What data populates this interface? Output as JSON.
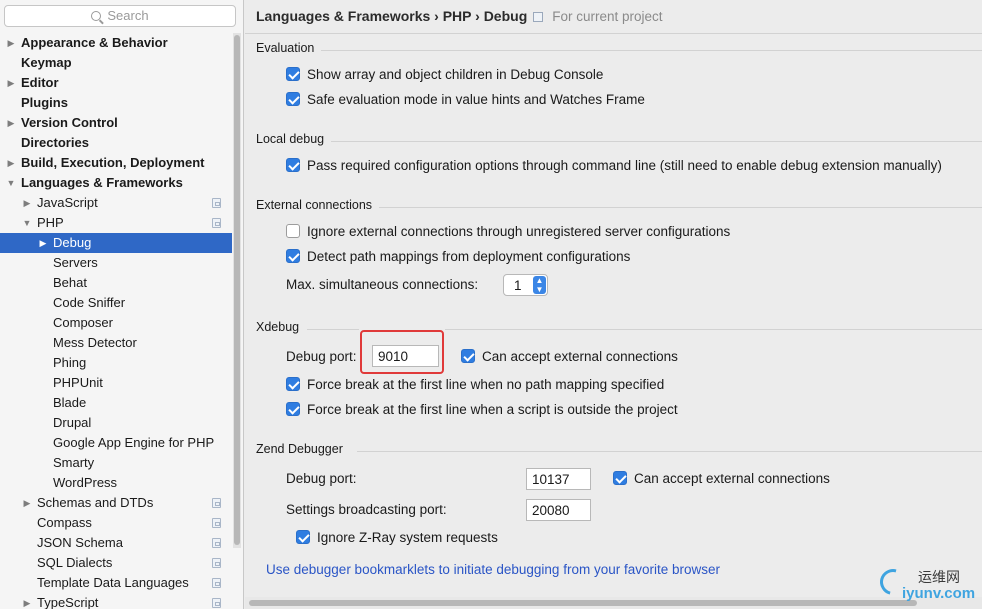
{
  "search": {
    "placeholder": "Search"
  },
  "sidebar": {
    "items": [
      {
        "label": "Appearance & Behavior",
        "arrow": "▶",
        "bold": true,
        "level": 0
      },
      {
        "label": "Keymap",
        "arrow": "",
        "bold": true,
        "level": 0
      },
      {
        "label": "Editor",
        "arrow": "▶",
        "bold": true,
        "level": 0
      },
      {
        "label": "Plugins",
        "arrow": "",
        "bold": true,
        "level": 0
      },
      {
        "label": "Version Control",
        "arrow": "▶",
        "bold": true,
        "level": 0
      },
      {
        "label": "Directories",
        "arrow": "",
        "bold": true,
        "level": 0
      },
      {
        "label": "Build, Execution, Deployment",
        "arrow": "▶",
        "bold": true,
        "level": 0
      },
      {
        "label": "Languages & Frameworks",
        "arrow": "▼",
        "bold": true,
        "level": 0
      },
      {
        "label": "JavaScript",
        "arrow": "▶",
        "bold": false,
        "level": 1,
        "project": true
      },
      {
        "label": "PHP",
        "arrow": "▼",
        "bold": false,
        "level": 1,
        "project": true
      },
      {
        "label": "Debug",
        "arrow": "▶",
        "bold": false,
        "level": 2,
        "selected": true
      },
      {
        "label": "Servers",
        "arrow": "",
        "bold": false,
        "level": 2
      },
      {
        "label": "Behat",
        "arrow": "",
        "bold": false,
        "level": 2
      },
      {
        "label": "Code Sniffer",
        "arrow": "",
        "bold": false,
        "level": 2
      },
      {
        "label": "Composer",
        "arrow": "",
        "bold": false,
        "level": 2
      },
      {
        "label": "Mess Detector",
        "arrow": "",
        "bold": false,
        "level": 2
      },
      {
        "label": "Phing",
        "arrow": "",
        "bold": false,
        "level": 2
      },
      {
        "label": "PHPUnit",
        "arrow": "",
        "bold": false,
        "level": 2
      },
      {
        "label": "Blade",
        "arrow": "",
        "bold": false,
        "level": 2
      },
      {
        "label": "Drupal",
        "arrow": "",
        "bold": false,
        "level": 2
      },
      {
        "label": "Google App Engine for PHP",
        "arrow": "",
        "bold": false,
        "level": 2
      },
      {
        "label": "Smarty",
        "arrow": "",
        "bold": false,
        "level": 2
      },
      {
        "label": "WordPress",
        "arrow": "",
        "bold": false,
        "level": 2
      },
      {
        "label": "Schemas and DTDs",
        "arrow": "▶",
        "bold": false,
        "level": 1,
        "project": true
      },
      {
        "label": "Compass",
        "arrow": "",
        "bold": false,
        "level": 1,
        "project": true
      },
      {
        "label": "JSON Schema",
        "arrow": "",
        "bold": false,
        "level": 1,
        "project": true
      },
      {
        "label": "SQL Dialects",
        "arrow": "",
        "bold": false,
        "level": 1,
        "project": true
      },
      {
        "label": "Template Data Languages",
        "arrow": "",
        "bold": false,
        "level": 1,
        "project": true
      },
      {
        "label": "TypeScript",
        "arrow": "▶",
        "bold": false,
        "level": 1,
        "project": true
      }
    ]
  },
  "breadcrumb": {
    "path": "Languages & Frameworks › PHP › Debug",
    "scope": "For current project"
  },
  "evaluation": {
    "title": "Evaluation",
    "show_array": "Show array and object children in Debug Console",
    "safe_mode": "Safe evaluation mode in value hints and Watches Frame"
  },
  "local_debug": {
    "title": "Local debug",
    "pass_options": "Pass required configuration options through command line (still need to enable debug extension manually)"
  },
  "external": {
    "title": "External connections",
    "ignore_unregistered": "Ignore external connections through unregistered server configurations",
    "detect_mappings": "Detect path mappings from deployment configurations",
    "max_label": "Max. simultaneous connections:",
    "max_value": "1"
  },
  "xdebug": {
    "title": "Xdebug",
    "port_label": "Debug port:",
    "port_value": "9010",
    "accept_external": "Can accept external connections",
    "force_break_no_mapping": "Force break at the first line when no path mapping specified",
    "force_break_outside": "Force break at the first line when a script is outside the project"
  },
  "zend": {
    "title": "Zend Debugger",
    "port_label": "Debug port:",
    "port_value": "10137",
    "accept_external": "Can accept external connections",
    "broadcast_label": "Settings broadcasting port:",
    "broadcast_value": "20080",
    "ignore_zray": "Ignore Z-Ray system requests"
  },
  "bookmarklets_link": "Use debugger bookmarklets to initiate debugging from your favorite browser",
  "watermark": {
    "cn": "运维网",
    "url": "iyunv.com"
  },
  "colors": {
    "selection": "#2f68c6",
    "checkbox": "#2f7de1",
    "link": "#2a55c6",
    "highlight": "#e03a3a"
  }
}
